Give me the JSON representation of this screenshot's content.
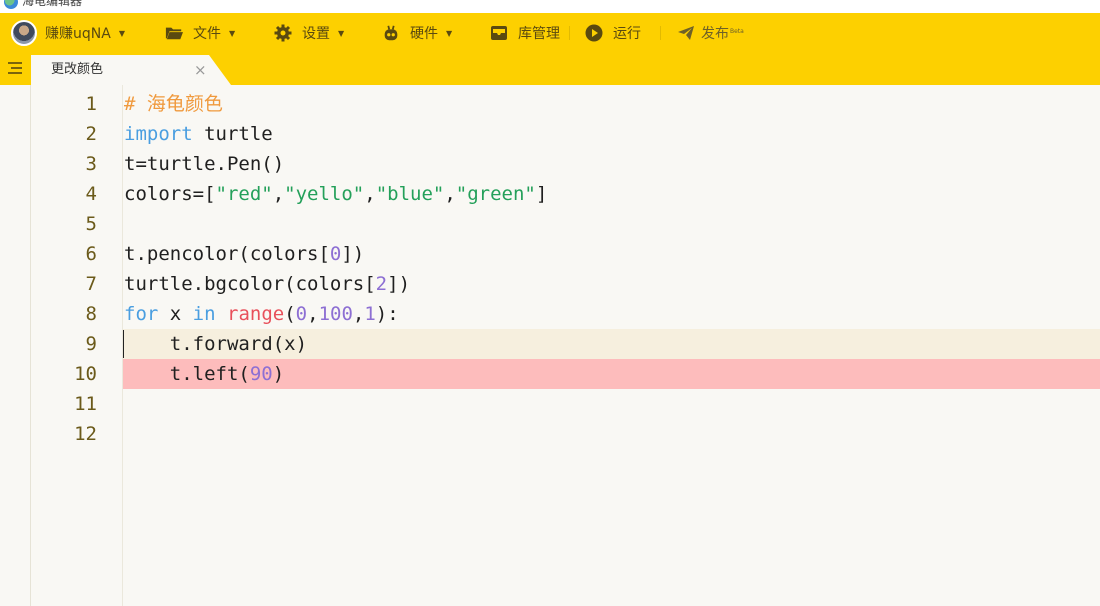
{
  "window": {
    "title": "海龟编辑器"
  },
  "toolbar": {
    "user": "赚赚uqNA",
    "file": "文件",
    "settings": "设置",
    "hardware": "硬件",
    "library": "库管理",
    "run": "运行",
    "publish": "发布",
    "publish_badge": "Beta"
  },
  "tab": {
    "label": "更改颜色",
    "close": "×"
  },
  "editor": {
    "line_numbers": [
      "1",
      "2",
      "3",
      "4",
      "5",
      "6",
      "7",
      "8",
      "9",
      "10",
      "11",
      "12"
    ],
    "lines": [
      [
        {
          "t": "# 海龟颜色",
          "c": "comment"
        }
      ],
      [
        {
          "t": "import",
          "c": "kw"
        },
        {
          "t": " turtle",
          "c": ""
        }
      ],
      [
        {
          "t": "t=turtle.Pen()",
          "c": ""
        }
      ],
      [
        {
          "t": "colors=[",
          "c": ""
        },
        {
          "t": "\"red\"",
          "c": "str"
        },
        {
          "t": ",",
          "c": ""
        },
        {
          "t": "\"yello\"",
          "c": "str"
        },
        {
          "t": ",",
          "c": ""
        },
        {
          "t": "\"blue\"",
          "c": "str"
        },
        {
          "t": ",",
          "c": ""
        },
        {
          "t": "\"green\"",
          "c": "str"
        },
        {
          "t": "]",
          "c": ""
        }
      ],
      [],
      [
        {
          "t": "t.pencolor(colors[",
          "c": ""
        },
        {
          "t": "0",
          "c": "num"
        },
        {
          "t": "])",
          "c": ""
        }
      ],
      [
        {
          "t": "turtle.bgcolor(colors[",
          "c": ""
        },
        {
          "t": "2",
          "c": "num"
        },
        {
          "t": "])",
          "c": ""
        }
      ],
      [
        {
          "t": "for",
          "c": "kw"
        },
        {
          "t": " x ",
          "c": ""
        },
        {
          "t": "in",
          "c": "kw"
        },
        {
          "t": " ",
          "c": ""
        },
        {
          "t": "range",
          "c": "builtin"
        },
        {
          "t": "(",
          "c": ""
        },
        {
          "t": "0",
          "c": "num"
        },
        {
          "t": ",",
          "c": ""
        },
        {
          "t": "100",
          "c": "num"
        },
        {
          "t": ",",
          "c": ""
        },
        {
          "t": "1",
          "c": "num"
        },
        {
          "t": "):",
          "c": ""
        }
      ],
      [
        {
          "t": "    t.forward(x)",
          "c": ""
        }
      ],
      [
        {
          "t": "    t.left(",
          "c": ""
        },
        {
          "t": "90",
          "c": "num"
        },
        {
          "t": ")",
          "c": ""
        }
      ],
      [],
      []
    ],
    "active_line": 9,
    "error_line": 10
  },
  "colors": {
    "accent": "#fdd000",
    "editor_bg": "#f9f8f4",
    "active_line": "#f6efde",
    "error_line": "#fdbcbc",
    "comment": "#f09a3e",
    "keyword": "#4a9ee0",
    "string": "#24a05a",
    "number": "#8d6fd3",
    "builtin": "#e8505b"
  }
}
